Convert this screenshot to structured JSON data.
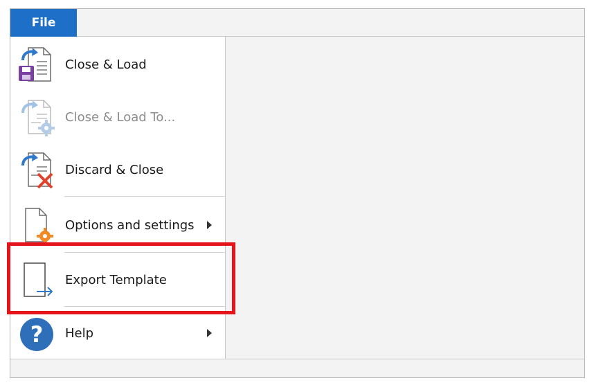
{
  "header": {
    "file_tab": "File"
  },
  "menu": {
    "items": [
      {
        "label": "Close & Load",
        "icon": "close-and-load-icon",
        "enabled": true
      },
      {
        "label": "Close & Load To...",
        "icon": "close-and-load-to-icon",
        "enabled": false
      },
      {
        "label": "Discard & Close",
        "icon": "discard-and-close-icon",
        "enabled": true
      },
      {
        "label": "Options and settings",
        "icon": "options-settings-icon",
        "enabled": true,
        "submenu": true
      },
      {
        "label": "Export Template",
        "icon": "export-template-icon",
        "enabled": true,
        "highlighted": true
      },
      {
        "label": "Help",
        "icon": "help-icon",
        "enabled": true,
        "submenu": true
      }
    ]
  },
  "colors": {
    "file_tab": "#1e6fc7",
    "highlight": "#e5141b",
    "save_purple": "#7a3fa3",
    "arrow_blue": "#2f79c8",
    "gear_orange": "#f08a24",
    "discard_red": "#e0422b",
    "help_blue": "#2f6fba"
  }
}
